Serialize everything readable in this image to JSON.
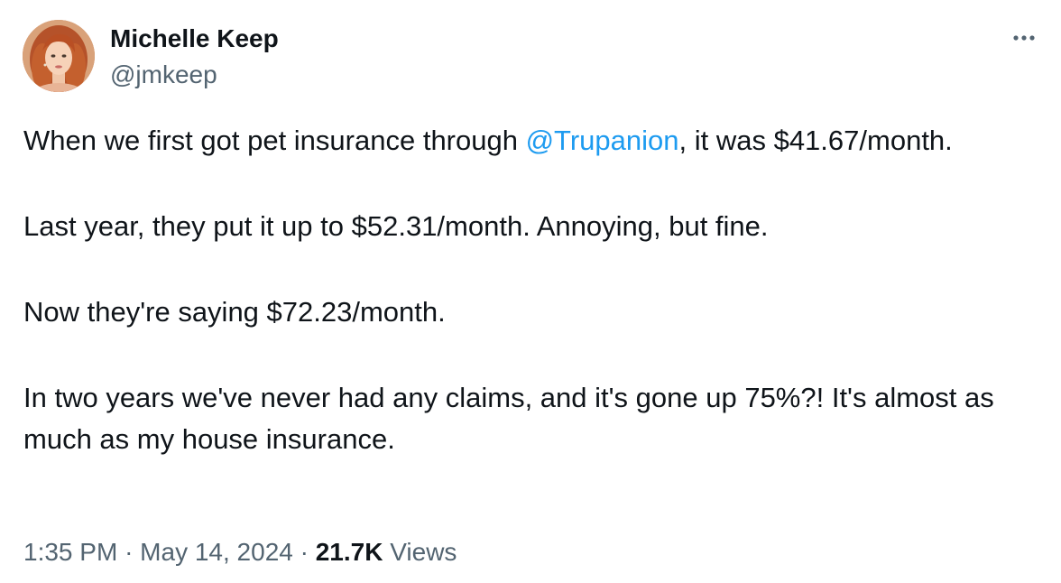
{
  "author": {
    "display_name": "Michelle Keep",
    "handle": "@jmkeep"
  },
  "tweet": {
    "paragraphs": [
      {
        "before": "When we first got pet insurance through ",
        "mention": "@Trupanion",
        "after": ", it was $41.67/month."
      },
      {
        "text": "Last year, they put it up to $52.31/month. Annoying, but fine."
      },
      {
        "text": "Now they're saying $72.23/month."
      },
      {
        "text": "In two years we've never had any claims, and it's gone up 75%?! It's almost as much as my house insurance."
      }
    ]
  },
  "meta": {
    "time": "1:35 PM",
    "separator": "·",
    "date": "May 14, 2024",
    "views_count": "21.7K",
    "views_label": "Views"
  },
  "icons": {
    "more": "more-horizontal-icon"
  },
  "colors": {
    "text": "#0f1419",
    "secondary": "#536471",
    "link": "#1d9bf0"
  }
}
